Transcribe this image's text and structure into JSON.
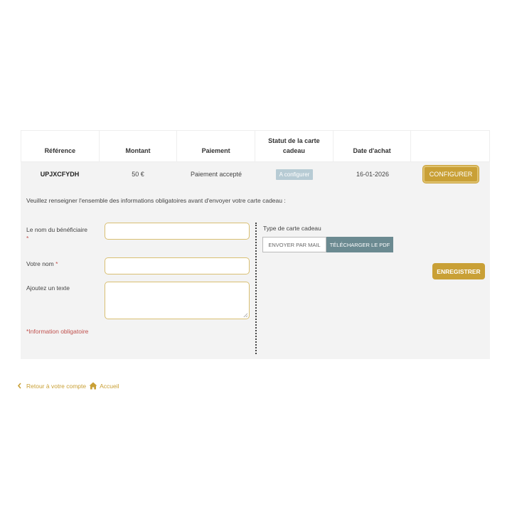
{
  "table": {
    "headers": [
      "Référence",
      "Montant",
      "Paiement",
      "Statut de la carte cadeau",
      "Date d'achat",
      ""
    ],
    "row": {
      "reference": "UPJXCFYDH",
      "amount": "50 €",
      "payment": "Paiement accepté",
      "status": "A configurer",
      "date": "16-01-2026",
      "action": "CONFIGURER"
    }
  },
  "form": {
    "notice": "Veuillez renseigner l'ensemble des informations obligatoires avant d'envoyer votre carte cadeau :",
    "beneficiary_label": "Le nom du bénéficiaire",
    "your_name_label": "Votre nom",
    "text_label": "Ajoutez un texte",
    "required_mark": "*",
    "required_note": "*Information obligatoire",
    "card_type_label": "Type de carte cadeau",
    "send_mail": "ENVOYER PAR MAIL",
    "download_pdf": "TÉLÉCHARGER LE PDF",
    "save": "ENREGISTRER"
  },
  "footer": {
    "back_label": "Retour à votre compte",
    "home_label": "Accueil"
  },
  "colors": {
    "accent": "#c9a036",
    "status_badge": "#b7cbd4",
    "pdf_active": "#6b8a91",
    "required": "#c0504d"
  },
  "icons": {
    "back": "chevron-left-icon",
    "home": "home-icon"
  }
}
